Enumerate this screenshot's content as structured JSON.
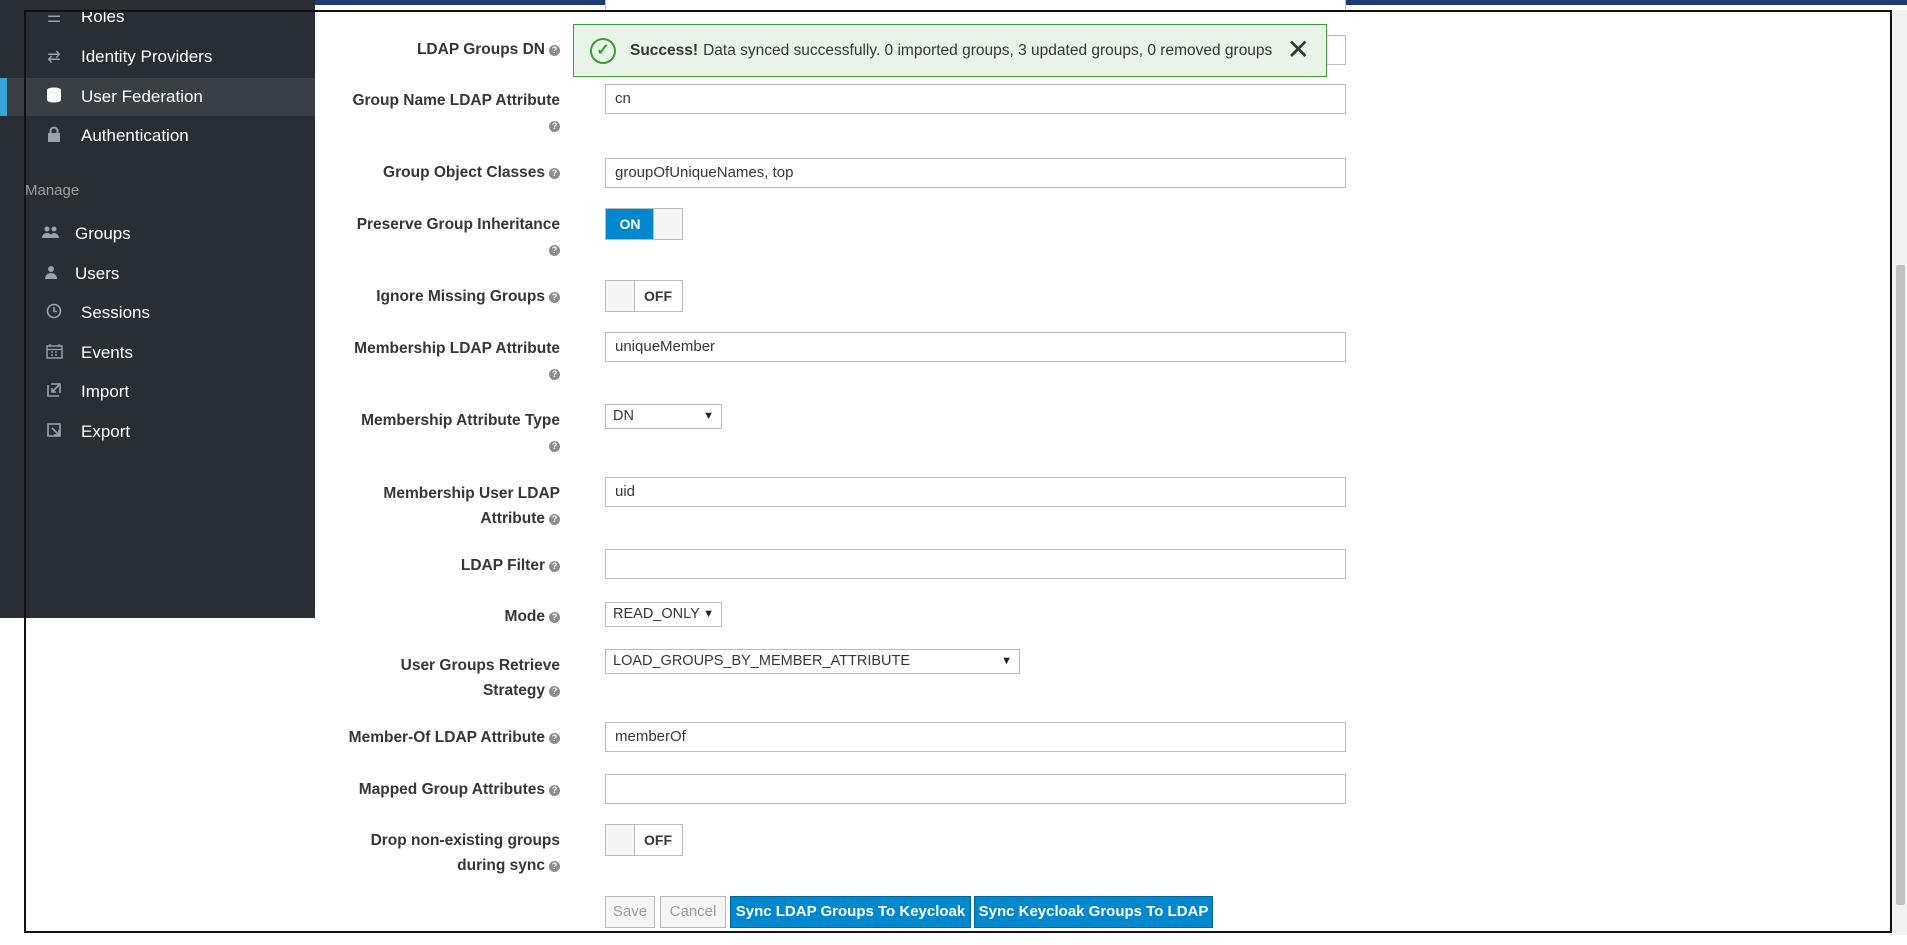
{
  "sidebar": {
    "items": [
      {
        "label": "Roles",
        "icon": "roles-icon"
      },
      {
        "label": "Identity Providers",
        "icon": "exchange-icon"
      },
      {
        "label": "User Federation",
        "icon": "database-icon"
      },
      {
        "label": "Authentication",
        "icon": "lock-icon"
      }
    ],
    "manage_label": "Manage",
    "manage_items": [
      {
        "label": "Groups",
        "icon": "groups-icon"
      },
      {
        "label": "Users",
        "icon": "user-icon"
      },
      {
        "label": "Sessions",
        "icon": "clock-icon"
      },
      {
        "label": "Events",
        "icon": "calendar-icon"
      },
      {
        "label": "Import",
        "icon": "import-icon"
      },
      {
        "label": "Export",
        "icon": "export-icon"
      }
    ]
  },
  "alert": {
    "title": "Success!",
    "message": "Data synced successfully. 0 imported groups, 3 updated groups, 0 removed groups"
  },
  "form": {
    "ldap_groups_dn": {
      "label": "LDAP Groups DN"
    },
    "group_name_attr": {
      "label": "Group Name LDAP Attribute",
      "value": "cn"
    },
    "group_object_classes": {
      "label": "Group Object Classes",
      "value": "groupOfUniqueNames, top"
    },
    "preserve_inheritance": {
      "label": "Preserve Group Inheritance",
      "state": "ON"
    },
    "ignore_missing": {
      "label": "Ignore Missing Groups",
      "state": "OFF"
    },
    "membership_attr": {
      "label": "Membership LDAP Attribute",
      "value": "uniqueMember"
    },
    "membership_type": {
      "label": "Membership Attribute Type",
      "value": "DN"
    },
    "membership_user_attr": {
      "label_line1": "Membership User LDAP",
      "label_line2": "Attribute",
      "value": "uid"
    },
    "ldap_filter": {
      "label": "LDAP Filter",
      "value": ""
    },
    "mode": {
      "label": "Mode",
      "value": "READ_ONLY"
    },
    "retrieve_strategy": {
      "label_line1": "User Groups Retrieve",
      "label_line2": "Strategy",
      "value": "LOAD_GROUPS_BY_MEMBER_ATTRIBUTE"
    },
    "member_of_attr": {
      "label": "Member-Of LDAP Attribute",
      "value": "memberOf"
    },
    "mapped_group_attrs": {
      "label": "Mapped Group Attributes",
      "value": ""
    },
    "drop_nonexisting": {
      "label_line1": "Drop non-existing groups",
      "label_line2": "during sync",
      "state": "OFF"
    }
  },
  "buttons": {
    "save": "Save",
    "cancel": "Cancel",
    "sync_to_keycloak": "Sync LDAP Groups To Keycloak",
    "sync_to_ldap": "Sync Keycloak Groups To LDAP"
  },
  "colors": {
    "sidebar_bg": "#292e34",
    "accent": "#0088ce",
    "success": "#3f9c35"
  }
}
